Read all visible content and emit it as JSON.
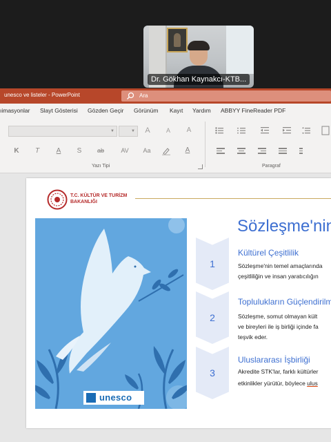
{
  "video_call": {
    "participant_name": "Dr. Gökhan Kaynakcı-KTB..."
  },
  "window": {
    "title": "unesco ve listeler  -  PowerPoint",
    "search_placeholder": "Ara",
    "accent_color": "#b7472a"
  },
  "ribbon_tabs": [
    "ıimasyonlar",
    "Slayt Gösterisi",
    "Gözden Geçir",
    "Görünüm",
    "Kayıt",
    "Yardım",
    "ABBYY FineReader PDF"
  ],
  "ribbon": {
    "font_group_label": "Yazı Tipi",
    "paragraph_group_label": "Paragraf",
    "font_buttons": {
      "grow": "A",
      "shrink": "A",
      "clear": "A",
      "bold": "K",
      "italic": "T",
      "underline": "A",
      "strikethrough": "S",
      "shadow": "ab",
      "spacing": "AV",
      "case": "Aa",
      "font_color": "A"
    }
  },
  "slide": {
    "logo_line1": "T.C. KÜLTÜR VE TURİZM",
    "logo_line2": "BAKANLIĞI",
    "title": "Sözleşme'nin",
    "poster_logo_text": "unesco",
    "items": [
      {
        "number": "1",
        "title": "Kültürel Çeşitlilik",
        "text_line1": "Sözleşme'nin temel amaçlarında",
        "text_line2": "çeşitliliğin ve insan yaratıcılığın"
      },
      {
        "number": "2",
        "title": "Toplulukların Güçlendirilm",
        "text_line1": "Sözleşme, somut olmayan kült",
        "text_line2": "ve bireyleri ile iş birliği içinde fa",
        "text_line3": "teşvik eder."
      },
      {
        "number": "3",
        "title": "Uluslararası İşbirliği",
        "text_line1": "Akredite STK'lar, farklı kültürler",
        "text_line2_a": "etkinlikler yürütür, böylece ",
        "text_line2_b": "ulus"
      }
    ]
  }
}
